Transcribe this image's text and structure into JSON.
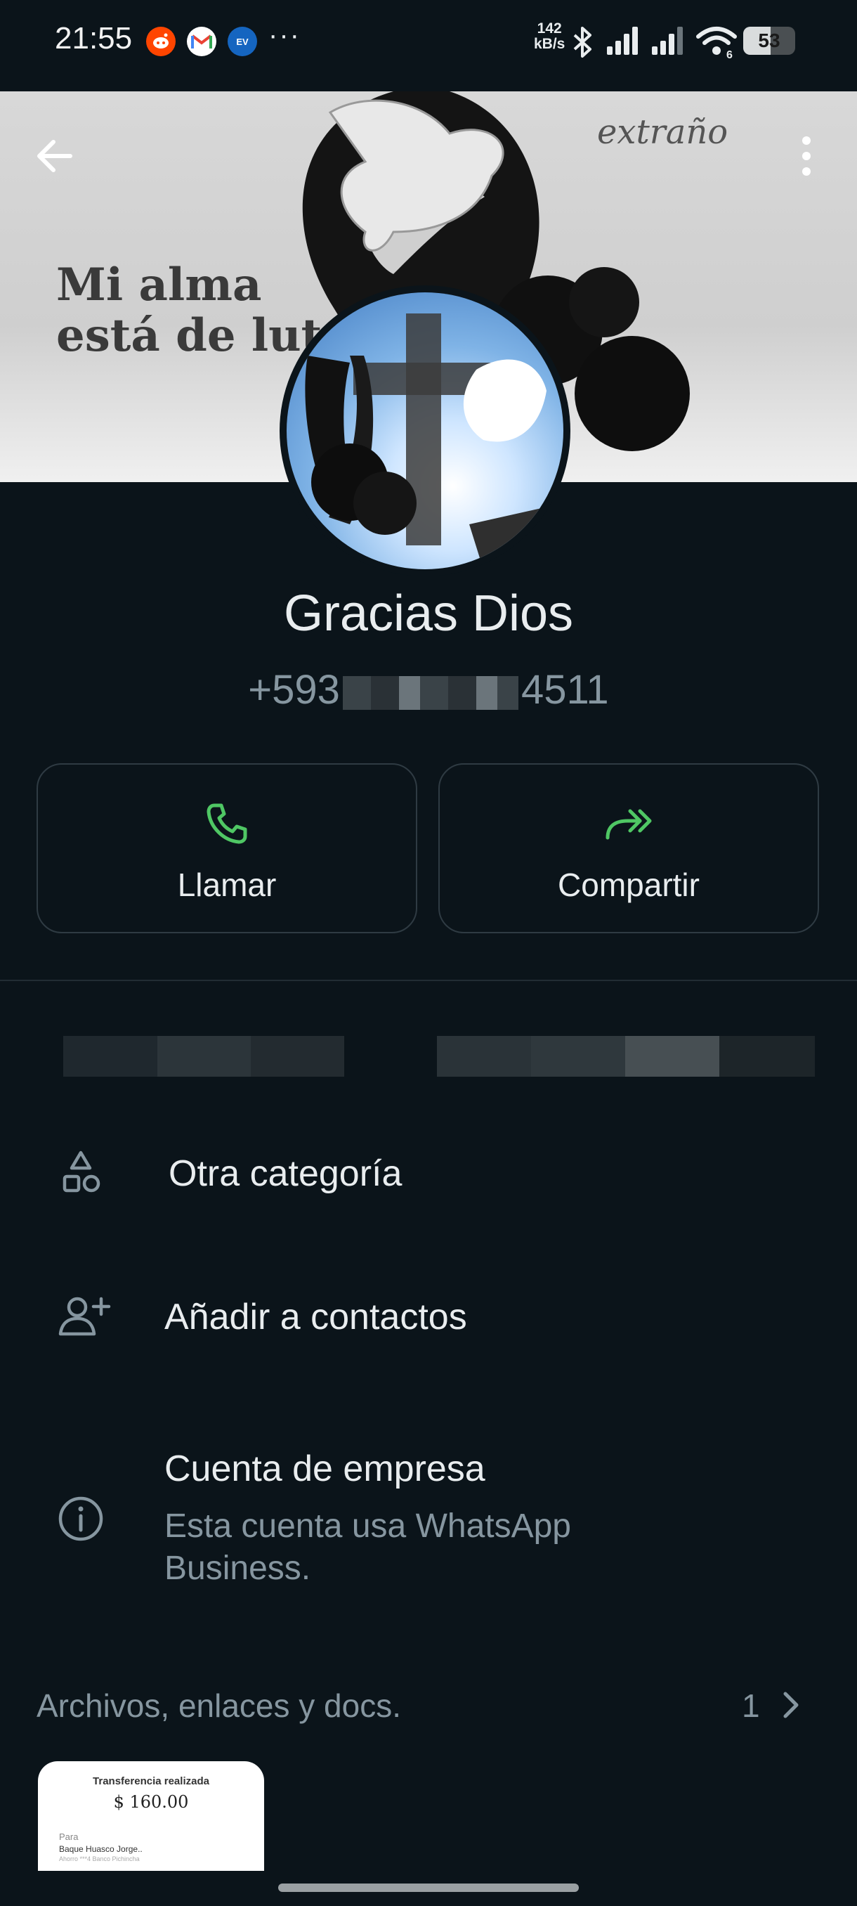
{
  "status_bar": {
    "time": "21:55",
    "notification_icons": [
      "reddit-icon",
      "gmail-icon",
      "ecuavisa-play-icon"
    ],
    "more": "···",
    "net_speed_value": "142",
    "net_speed_unit": "kB/s",
    "wifi_badge": "6",
    "battery_level": "53"
  },
  "header": {
    "back_icon": "arrow-left-icon",
    "menu_icon": "kebab-menu-icon"
  },
  "cover": {
    "text_line1": "Mi alma",
    "text_line2": "está de luto",
    "script_text": "extraño"
  },
  "profile": {
    "name": "Gracias Dios",
    "phone_prefix": "+593",
    "phone_suffix": "4511"
  },
  "actions": {
    "call_label": "Llamar",
    "share_label": "Compartir",
    "accent_color": "#4fc764"
  },
  "info": {
    "category": "Otra categoría",
    "add_contact": "Añadir a contactos",
    "business_title": "Cuenta de empresa",
    "business_sub": "Esta cuenta usa WhatsApp Business."
  },
  "media": {
    "title": "Archivos, enlaces y docs.",
    "count": "1",
    "thumb_title": "Transferencia realizada",
    "thumb_amount": "$ 160.00",
    "thumb_para": "Para",
    "thumb_name": "Baque Huasco Jorge..",
    "thumb_bank": "Ahorro ***4 Banco Pichincha"
  }
}
